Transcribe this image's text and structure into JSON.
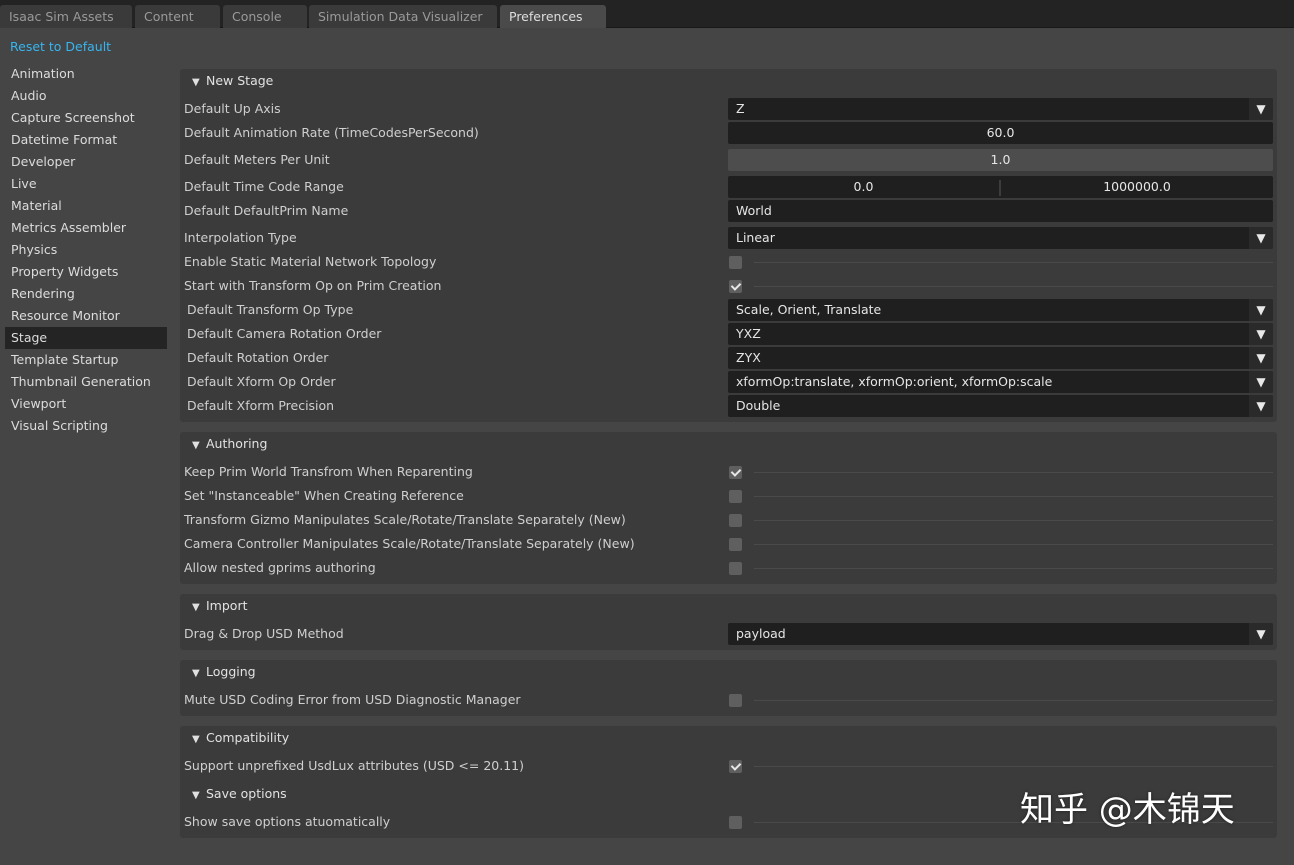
{
  "tabs": [
    "Isaac Sim Assets",
    "Content",
    "Console",
    "Simulation Data Visualizer",
    "Preferences"
  ],
  "reset_label": "Reset to Default",
  "sidebar": [
    "Animation",
    "Audio",
    "Capture Screenshot",
    "Datetime Format",
    "Developer",
    "Live",
    "Material",
    "Metrics Assembler",
    "Physics",
    "Property Widgets",
    "Rendering",
    "Resource Monitor",
    "Stage",
    "Template Startup",
    "Thumbnail Generation",
    "Viewport",
    "Visual Scripting"
  ],
  "sidebar_active": "Stage",
  "new_stage": {
    "title": "New Stage",
    "up_axis": {
      "label": "Default Up Axis",
      "value": "Z"
    },
    "anim_rate": {
      "label": "Default Animation Rate (TimeCodesPerSecond)",
      "value": "60.0"
    },
    "meters": {
      "label": "Default Meters Per Unit",
      "value": "1.0"
    },
    "time_range": {
      "label": "Default Time Code Range",
      "start": "0.0",
      "end": "1000000.0"
    },
    "default_prim": {
      "label": "Default DefaultPrim Name",
      "value": "World"
    },
    "interp": {
      "label": "Interpolation Type",
      "value": "Linear"
    },
    "static_mat": {
      "label": "Enable Static Material Network Topology",
      "checked": false
    },
    "start_xform": {
      "label": "Start with Transform Op on Prim Creation",
      "checked": true
    },
    "xform_op_type": {
      "label": "Default Transform Op Type",
      "value": "Scale, Orient, Translate"
    },
    "cam_rot": {
      "label": "Default Camera Rotation Order",
      "value": "YXZ"
    },
    "rot_order": {
      "label": "Default Rotation Order",
      "value": "ZYX"
    },
    "xform_order": {
      "label": "Default Xform Op Order",
      "value": "xformOp:translate, xformOp:orient, xformOp:scale"
    },
    "xform_prec": {
      "label": "Default Xform Precision",
      "value": "Double"
    }
  },
  "authoring": {
    "title": "Authoring",
    "items": [
      {
        "label": "Keep Prim World Transfrom When Reparenting",
        "checked": true
      },
      {
        "label": "Set \"Instanceable\" When Creating Reference",
        "checked": false
      },
      {
        "label": "Transform Gizmo Manipulates Scale/Rotate/Translate Separately (New)",
        "checked": false
      },
      {
        "label": "Camera Controller Manipulates Scale/Rotate/Translate Separately (New)",
        "checked": false
      },
      {
        "label": "Allow nested gprims authoring",
        "checked": false
      }
    ]
  },
  "import": {
    "title": "Import",
    "drag_drop": {
      "label": "Drag & Drop USD Method",
      "value": "payload"
    }
  },
  "logging": {
    "title": "Logging",
    "mute": {
      "label": "Mute USD Coding Error from USD Diagnostic Manager",
      "checked": false
    }
  },
  "compat": {
    "title": "Compatibility",
    "usdlux": {
      "label": "Support unprefixed UsdLux attributes (USD <= 20.11)",
      "checked": true
    }
  },
  "save": {
    "title": "Save options",
    "show": {
      "label": "Show save options atuomatically",
      "checked": false
    }
  },
  "icons": {
    "collapse": "triangle-down-icon",
    "dropdown": "dropdown-arrow-icon",
    "check": "checkmark-icon"
  },
  "colors": {
    "accent": "#36b5f0",
    "background": "#454545",
    "panel": "#3b3b3b",
    "field": "#1f1f1f"
  },
  "watermark": "知乎 @木锦天"
}
